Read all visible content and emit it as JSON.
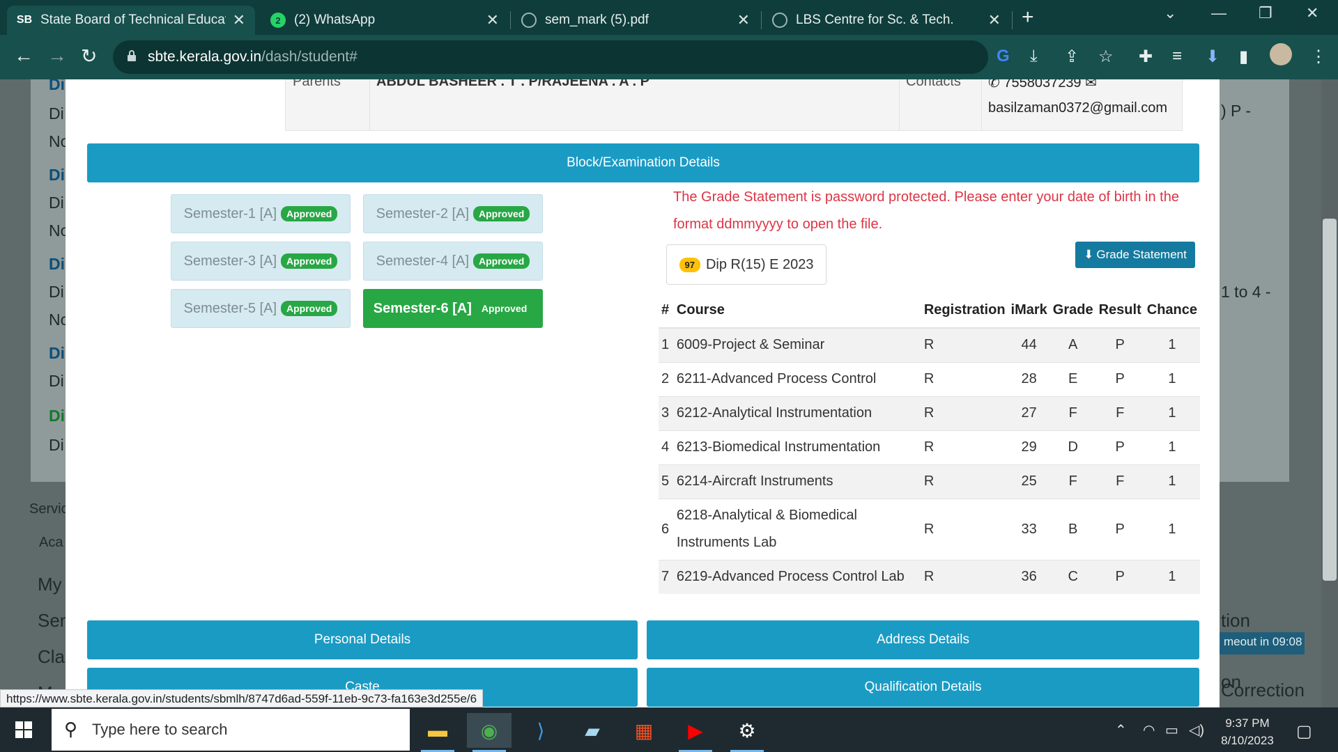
{
  "browser": {
    "tabs": [
      {
        "favicon": "SB",
        "title": "State Board of Technical Educatio"
      },
      {
        "favicon": "2",
        "title": "(2) WhatsApp"
      },
      {
        "favicon": "globe",
        "title": "sem_mark (5).pdf"
      },
      {
        "favicon": "globe",
        "title": "LBS Centre for Sc. & Tech."
      }
    ],
    "url_domain": "sbte.kerala.gov.in",
    "url_path": "/dash/student#",
    "status_url": "https://www.sbte.kerala.gov.in/students/sbmlh/8747d6ad-559f-11eb-9c73-fa163e3d255e/6"
  },
  "background": {
    "left_labels": [
      "Di",
      "Di",
      "No",
      "Di",
      "Di",
      "No",
      "Di",
      "Di",
      "No",
      "Di",
      "Di",
      "Di",
      "Di"
    ],
    "services_label": "Servic",
    "acad_label": "Aca",
    "menu_items": [
      "My",
      "Sem",
      "Clas",
      "M"
    ],
    "right_snippets": [
      ") P -",
      "1 to 4 -",
      "tion",
      "on",
      "Correction"
    ],
    "timeout_text": "meout in 09:08"
  },
  "modal": {
    "parents_label": "Parents",
    "parents_value": "ABDUL BASHEER . T . P/RAJEENA . A . P",
    "contacts_label": "Contacts",
    "phone": "7558037239",
    "email": "basilzaman0372@gmail.com",
    "block_header": "Block/Examination Details",
    "semesters": [
      {
        "label": "Semester-1 [A]",
        "status": "Approved"
      },
      {
        "label": "Semester-2 [A]",
        "status": "Approved"
      },
      {
        "label": "Semester-3 [A]",
        "status": "Approved"
      },
      {
        "label": "Semester-4 [A]",
        "status": "Approved"
      },
      {
        "label": "Semester-5 [A]",
        "status": "Approved"
      },
      {
        "label": "Semester-6 [A]",
        "status": "Approved"
      }
    ],
    "notice": "The Grade Statement is password protected. Please enter your date of birth in the format ddmmyyyy to open the file.",
    "exam_count": "97",
    "exam_name": "Dip R(15) E 2023",
    "grade_statement_btn": "Grade Statement",
    "table": {
      "headers": [
        "#",
        "Course",
        "Registration",
        "iMark",
        "Grade",
        "Result",
        "Chance"
      ],
      "rows": [
        [
          "1",
          "6009-Project & Seminar",
          "R",
          "44",
          "A",
          "P",
          "1"
        ],
        [
          "2",
          "6211-Advanced Process Control",
          "R",
          "28",
          "E",
          "P",
          "1"
        ],
        [
          "3",
          "6212-Analytical Instrumentation",
          "R",
          "27",
          "F",
          "F",
          "1"
        ],
        [
          "4",
          "6213-Biomedical Instrumentation",
          "R",
          "29",
          "D",
          "P",
          "1"
        ],
        [
          "5",
          "6214-Aircraft Instruments",
          "R",
          "25",
          "F",
          "F",
          "1"
        ],
        [
          "6",
          "6218-Analytical & Biomedical Instruments Lab",
          "R",
          "33",
          "B",
          "P",
          "1"
        ],
        [
          "7",
          "6219-Advanced Process Control Lab",
          "R",
          "36",
          "C",
          "P",
          "1"
        ]
      ]
    },
    "buttons": [
      "Personal Details",
      "Address Details",
      "Caste",
      "Qualification Details"
    ]
  },
  "taskbar": {
    "search_placeholder": "Type here to search",
    "time": "9:37 PM",
    "date": "8/10/2023"
  }
}
